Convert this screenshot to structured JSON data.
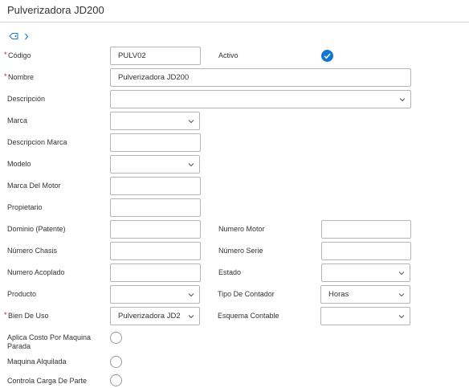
{
  "header": {
    "title": "Pulverizadora JD200"
  },
  "breadcrumb": {
    "tag_icon": "tag-icon",
    "chevron_icon": "chevron-right-icon"
  },
  "colors": {
    "accent": "#1177d0",
    "required": "#d11a1a",
    "border": "#b5b5b5"
  },
  "form": {
    "codigo": {
      "label": "Código",
      "value": "PULV02"
    },
    "activo": {
      "label": "Activo",
      "checked": true
    },
    "nombre": {
      "label": "Nombre",
      "value": "Pulverizadora JD200"
    },
    "descripcion": {
      "label": "Descripción",
      "value": ""
    },
    "marca": {
      "label": "Marca",
      "value": ""
    },
    "descripcion_marca": {
      "label": "Descripcion Marca",
      "value": ""
    },
    "modelo": {
      "label": "Modelo",
      "value": ""
    },
    "marca_motor": {
      "label": "Marca Del Motor",
      "value": ""
    },
    "propietario": {
      "label": "Propietario",
      "value": ""
    },
    "dominio": {
      "label": "Dominio (Patente)",
      "value": ""
    },
    "numero_motor": {
      "label": "Numero Motor",
      "value": ""
    },
    "numero_chasis": {
      "label": "Número Chasis",
      "value": ""
    },
    "numero_serie": {
      "label": "Número Serie",
      "value": ""
    },
    "numero_acoplado": {
      "label": "Numero Acoplado",
      "value": ""
    },
    "estado": {
      "label": "Estado",
      "value": ""
    },
    "producto": {
      "label": "Producto",
      "value": ""
    },
    "tipo_contador": {
      "label": "Tipo De Contador",
      "value": "Horas"
    },
    "bien_de_uso": {
      "label": "Bien De Uso",
      "value": "Pulverizadora JD2"
    },
    "esquema_contable": {
      "label": "Esquema Contable",
      "value": ""
    },
    "aplica_costo": {
      "label": "Aplica Costo Por Maquina Parada",
      "checked": false
    },
    "maquina_alquilada": {
      "label": "Maquina Alquilada",
      "checked": false
    },
    "controla_carga": {
      "label": "Controla Carga De Parte",
      "checked": false
    }
  }
}
